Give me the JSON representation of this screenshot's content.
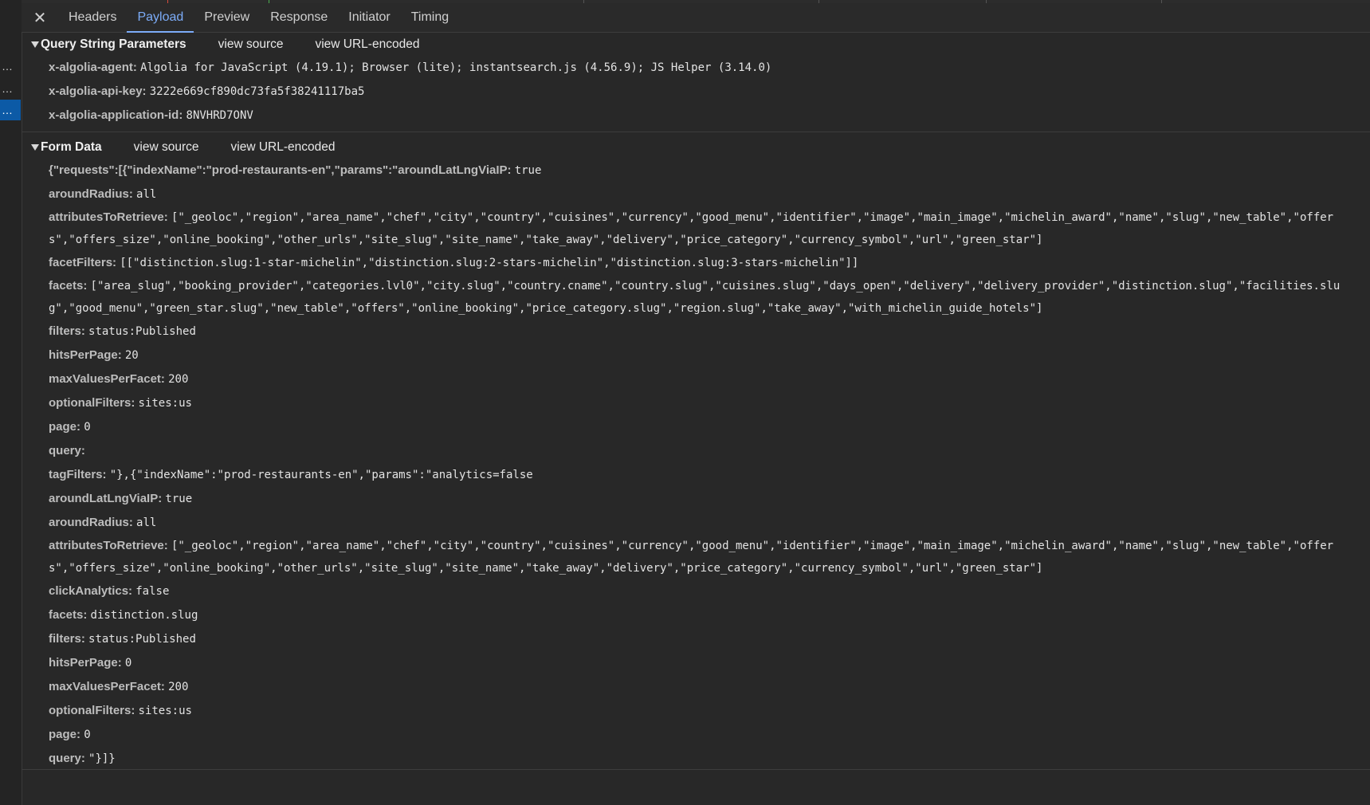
{
  "tabs": [
    "Headers",
    "Payload",
    "Preview",
    "Response",
    "Initiator",
    "Timing"
  ],
  "active_tab": "Payload",
  "left_strip": [
    "…",
    "…",
    "…"
  ],
  "query_section": {
    "title": "Query String Parameters",
    "view_source": "view source",
    "view_encoded": "view URL-encoded",
    "rows": [
      {
        "k": "x-algolia-agent:",
        "v": "Algolia for JavaScript (4.19.1); Browser (lite); instantsearch.js (4.56.9); JS Helper (3.14.0)"
      },
      {
        "k": "x-algolia-api-key:",
        "v": "3222e669cf890dc73fa5f38241117ba5"
      },
      {
        "k": "x-algolia-application-id:",
        "v": "8NVHRD7ONV"
      }
    ]
  },
  "form_section": {
    "title": "Form Data",
    "view_source": "view source",
    "view_encoded": "view URL-encoded",
    "rows": [
      {
        "k": "{\"requests\":[{\"indexName\":\"prod-restaurants-en\",\"params\":\"aroundLatLngViaIP:",
        "v": "true"
      },
      {
        "k": "aroundRadius:",
        "v": "all"
      },
      {
        "k": "attributesToRetrieve:",
        "v": "[\"_geoloc\",\"region\",\"area_name\",\"chef\",\"city\",\"country\",\"cuisines\",\"currency\",\"good_menu\",\"identifier\",\"image\",\"main_image\",\"michelin_award\",\"name\",\"slug\",\"new_table\",\"offers\",\"offers_size\",\"online_booking\",\"other_urls\",\"site_slug\",\"site_name\",\"take_away\",\"delivery\",\"price_category\",\"currency_symbol\",\"url\",\"green_star\"]",
        "wrap": true
      },
      {
        "k": "facetFilters:",
        "v": "[[\"distinction.slug:1-star-michelin\",\"distinction.slug:2-stars-michelin\",\"distinction.slug:3-stars-michelin\"]]"
      },
      {
        "k": "facets:",
        "v": "[\"area_slug\",\"booking_provider\",\"categories.lvl0\",\"city.slug\",\"country.cname\",\"country.slug\",\"cuisines.slug\",\"days_open\",\"delivery\",\"delivery_provider\",\"distinction.slug\",\"facilities.slug\",\"good_menu\",\"green_star.slug\",\"new_table\",\"offers\",\"online_booking\",\"price_category.slug\",\"region.slug\",\"take_away\",\"with_michelin_guide_hotels\"]",
        "wrap": true
      },
      {
        "k": "filters:",
        "v": "status:Published"
      },
      {
        "k": "hitsPerPage:",
        "v": "20"
      },
      {
        "k": "maxValuesPerFacet:",
        "v": "200"
      },
      {
        "k": "optionalFilters:",
        "v": "sites:us"
      },
      {
        "k": "page:",
        "v": "0"
      },
      {
        "k": "query:",
        "v": ""
      },
      {
        "k": "tagFilters:",
        "v": "\"},{\"indexName\":\"prod-restaurants-en\",\"params\":\"analytics=false"
      },
      {
        "k": "aroundLatLngViaIP:",
        "v": "true"
      },
      {
        "k": "aroundRadius:",
        "v": "all"
      },
      {
        "k": "attributesToRetrieve:",
        "v": "[\"_geoloc\",\"region\",\"area_name\",\"chef\",\"city\",\"country\",\"cuisines\",\"currency\",\"good_menu\",\"identifier\",\"image\",\"main_image\",\"michelin_award\",\"name\",\"slug\",\"new_table\",\"offers\",\"offers_size\",\"online_booking\",\"other_urls\",\"site_slug\",\"site_name\",\"take_away\",\"delivery\",\"price_category\",\"currency_symbol\",\"url\",\"green_star\"]",
        "wrap": true
      },
      {
        "k": "clickAnalytics:",
        "v": "false"
      },
      {
        "k": "facets:",
        "v": "distinction.slug"
      },
      {
        "k": "filters:",
        "v": "status:Published"
      },
      {
        "k": "hitsPerPage:",
        "v": "0"
      },
      {
        "k": "maxValuesPerFacet:",
        "v": "200"
      },
      {
        "k": "optionalFilters:",
        "v": "sites:us"
      },
      {
        "k": "page:",
        "v": "0"
      },
      {
        "k": "query:",
        "v": "\"}]}"
      }
    ]
  },
  "colors": {
    "background": "#282828",
    "accent": "#7cacf8",
    "selection": "#0c5aa6"
  }
}
